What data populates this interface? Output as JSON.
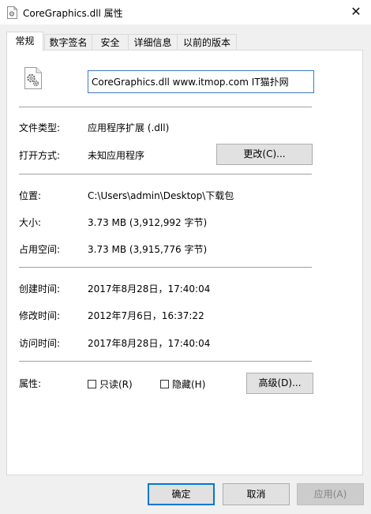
{
  "window": {
    "title": "CoreGraphics.dll 属性",
    "close_glyph": "✕"
  },
  "tabs": [
    {
      "label": "常规",
      "active": true
    },
    {
      "label": "数字签名",
      "active": false
    },
    {
      "label": "安全",
      "active": false
    },
    {
      "label": "详细信息",
      "active": false
    },
    {
      "label": "以前的版本",
      "active": false
    }
  ],
  "general": {
    "file_name_value": "CoreGraphics.dll www.itmop.com IT猫扑网",
    "file_type_label": "文件类型:",
    "file_type_value": "应用程序扩展 (.dll)",
    "open_with_label": "打开方式:",
    "open_with_value": "未知应用程序",
    "change_button": "更改(C)...",
    "location_label": "位置:",
    "location_value": "C:\\Users\\admin\\Desktop\\下载包",
    "size_label": "大小:",
    "size_value": "3.73 MB (3,912,992 字节)",
    "disk_size_label": "占用空间:",
    "disk_size_value": "3.73 MB (3,915,776 字节)",
    "created_label": "创建时间:",
    "created_value": "2017年8月28日，17:40:04",
    "modified_label": "修改时间:",
    "modified_value": "2012年7月6日，16:37:22",
    "accessed_label": "访问时间:",
    "accessed_value": "2017年8月28日，17:40:04",
    "attributes_label": "属性:",
    "readonly_label": "只读(R)",
    "readonly_checked": false,
    "hidden_label": "隐藏(H)",
    "hidden_checked": false,
    "advanced_button": "高级(D)..."
  },
  "footer": {
    "ok_button": "确定",
    "cancel_button": "取消",
    "apply_button": "应用(A)",
    "apply_enabled": false
  },
  "icons": {
    "title_icon": "file-gear-icon",
    "file_icon": "file-gear-icon"
  },
  "colors": {
    "focus_border": "#0078d7",
    "input_border": "#3e7cc6"
  }
}
